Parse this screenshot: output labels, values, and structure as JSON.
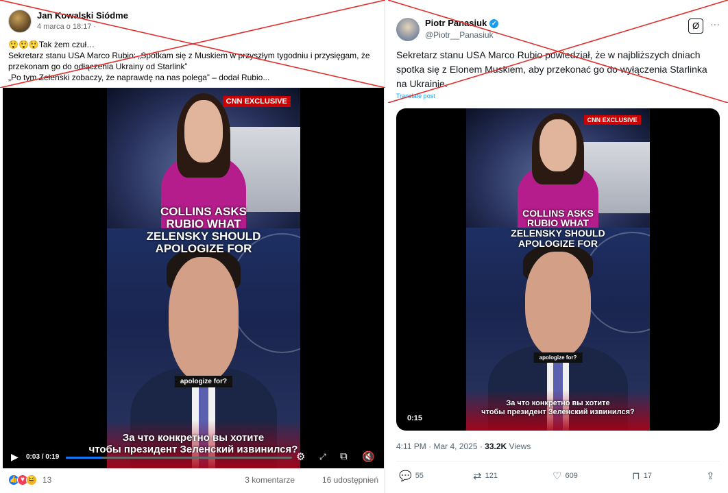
{
  "facebook": {
    "author": "Jan Kowalski Siódme",
    "date": "4 marca o 18:17 ·",
    "text_lines": [
      "😲😲😲Tak żem czuł…",
      "Sekretarz stanu USA Marco Rubio: „Spotkam się z Muskiem w przyszłym tygodniu i przysięgam, że",
      "przekonam go do odłączenia Ukrainy od Starlink”",
      "„Po tym Zełenski zobaczy, że naprawdę na nas polega” – dodał Rubio..."
    ],
    "video": {
      "badge": "CNN EXCLUSIVE",
      "headline_lines": [
        "COLLINS ASKS",
        "RUBIO WHAT",
        "ZELENSKY SHOULD",
        "APOLOGIZE FOR"
      ],
      "subtitle_en": "apologize for?",
      "subtitle_ru_lines": [
        "За что конкретно вы хотите",
        "чтобы президент Зеленский извинился?"
      ],
      "time": "0:03 / 0:19",
      "progress": 0.16
    },
    "reaction_count": "13",
    "comments": "3 komentarze",
    "shares": "16 udostępnień"
  },
  "x": {
    "name": "Piotr Panasiuk",
    "handle": "@Piotr__Panasiuk",
    "text_lines": [
      "Sekretarz stanu USA Marco Rubio powiedział, że w najbliższych dniach",
      "spotka się z Elonem Muskiem, aby przekonać go do wyłączenia Starlinka",
      "na Ukrainie."
    ],
    "translate": "Translate post",
    "video": {
      "badge": "CNN EXCLUSIVE",
      "headline_lines": [
        "COLLINS ASKS",
        "RUBIO WHAT",
        "ZELENSKY SHOULD",
        "APOLOGIZE FOR"
      ],
      "subtitle_en": "apologize for?",
      "subtitle_ru_lines": [
        "За что конкретно вы хотите",
        "чтобы президент Зеленский извинился?"
      ],
      "time": "0:15"
    },
    "meta_prefix": "4:11 PM · Mar 4, 2025 · ",
    "views_count": "33.2K",
    "views_label": " Views",
    "replies": "55",
    "reposts": "121",
    "likes": "609",
    "bookmarks": "17"
  },
  "colors": {
    "cross": "#e0302f",
    "fb_blue": "#1877f2",
    "x_blue": "#1d9bf0",
    "cnn_red": "#cc0000"
  },
  "icons": [
    "play-icon",
    "settings-icon",
    "fullscreen-icon",
    "pip-icon",
    "mute-icon",
    "verified-icon",
    "grok-icon",
    "more-icon",
    "reply-icon",
    "repost-icon",
    "like-icon",
    "bookmark-icon",
    "share-icon"
  ]
}
